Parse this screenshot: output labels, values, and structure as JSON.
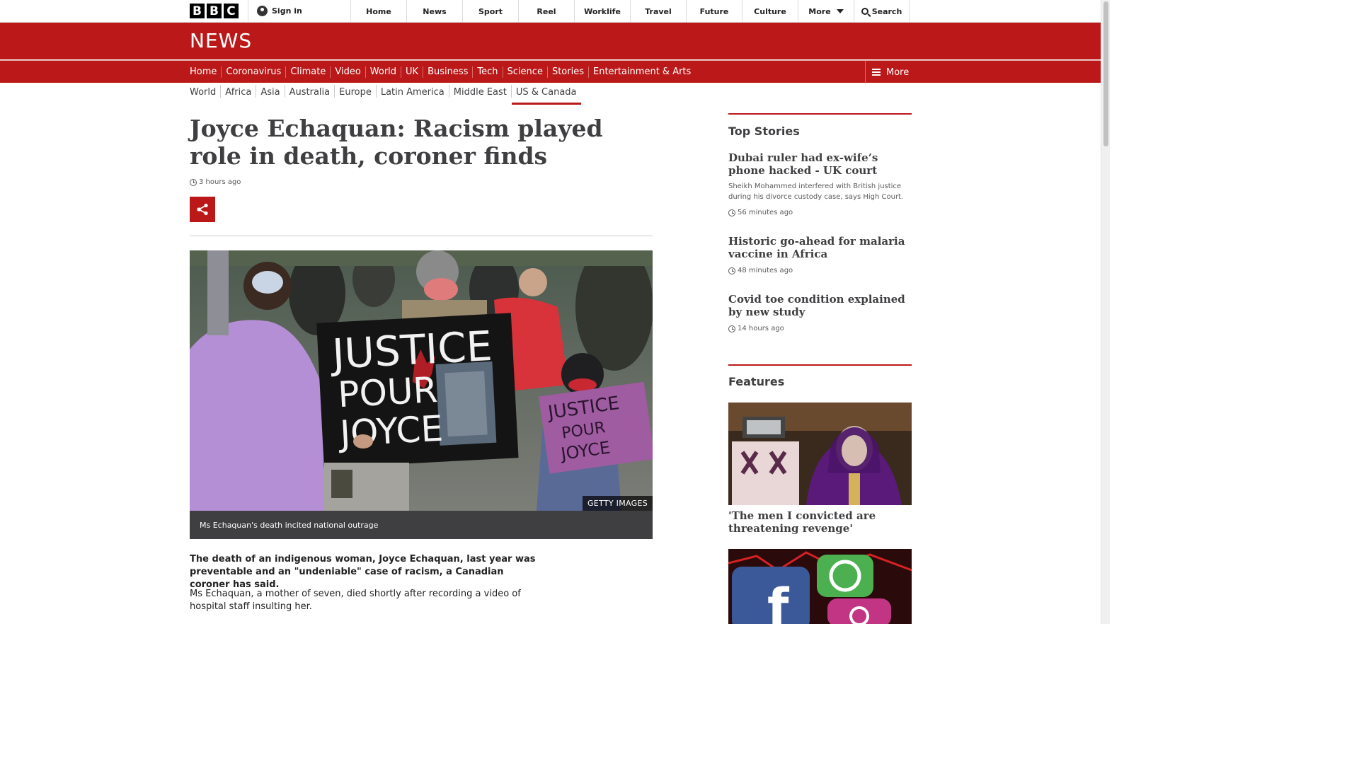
{
  "bbc_bar": {
    "logo_letters": [
      "B",
      "B",
      "C"
    ],
    "signin_label": "Sign in",
    "nav": [
      "Home",
      "News",
      "Sport",
      "Reel",
      "Worklife",
      "Travel",
      "Future",
      "Culture"
    ],
    "more_label": "More",
    "search_label": "Search"
  },
  "news_logo": "NEWS",
  "section_nav": {
    "items": [
      {
        "label": "Home"
      },
      {
        "label": "Coronavirus"
      },
      {
        "label": "Climate"
      },
      {
        "label": "Video"
      },
      {
        "label": "World"
      },
      {
        "label": "UK"
      },
      {
        "label": "Business"
      },
      {
        "label": "Tech"
      },
      {
        "label": "Science"
      },
      {
        "label": "Stories"
      },
      {
        "label": "Entertainment & Arts"
      }
    ],
    "active": "World",
    "more_label": "More"
  },
  "sub_nav": {
    "items": [
      "World",
      "Africa",
      "Asia",
      "Australia",
      "Europe",
      "Latin America",
      "Middle East",
      "US & Canada"
    ],
    "active": "US & Canada"
  },
  "article": {
    "headline": "Joyce Echaquan: Racism played role in death, coroner finds",
    "timestamp": "3 hours ago",
    "image_credit": "GETTY IMAGES",
    "image_caption": "Ms Echaquan's death incited national outrage",
    "sign_main": [
      "JUSTICE",
      "POUR",
      "JOYCE"
    ],
    "sign_small": [
      "JUSTICE",
      "POUR",
      "JOYCE"
    ],
    "intro": "The death of an indigenous woman, Joyce Echaquan, last year was preventable and an \"undeniable\" case of racism, a Canadian coroner has said.",
    "paragraph": "Ms Echaquan, a mother of seven, died shortly after recording a video of hospital staff insulting her."
  },
  "sidebar": {
    "top_stories_title": "Top Stories",
    "stories": [
      {
        "title": "Dubai ruler had ex-wife’s phone hacked - UK court",
        "summary": "Sheikh Mohammed interfered with British justice during his divorce custody case, says High Court.",
        "time": "56 minutes ago"
      },
      {
        "title": "Historic go-ahead for malaria vaccine in Africa",
        "summary": "",
        "time": "48 minutes ago"
      },
      {
        "title": "Covid toe condition explained by new study",
        "summary": "",
        "time": "14 hours ago"
      }
    ],
    "features_title": "Features",
    "features": [
      {
        "title": "'The men I convicted are threatening revenge'"
      }
    ]
  },
  "colors": {
    "bbc_red": "#bb1919",
    "text_dark": "#3f3f42",
    "caption_bg": "#3f3f42"
  }
}
